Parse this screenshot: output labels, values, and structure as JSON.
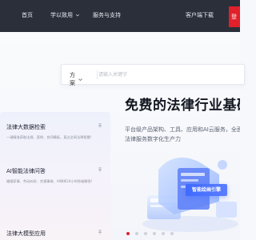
{
  "nav": {
    "items": [
      "首页",
      "学以致用",
      "服务与支持"
    ],
    "client_download": "客户端下载",
    "red_button": "登"
  },
  "search": {
    "scope": "方案",
    "placeholder": "请输入关键字"
  },
  "panel": {
    "items": [
      {
        "title": "法律大数据检索",
        "desc": "一键精准获取法规、案例、合同模板，直达全网法律智慧!"
      },
      {
        "title": "AI智能法律问答",
        "desc": "婚姻家事、劳动纠纷、交通事故，AI律师24小时秒级解答!"
      },
      {
        "title": "法律大模型应用",
        "desc": ""
      }
    ]
  },
  "hero": {
    "headline": "免费的法律行业基础设施",
    "sub_line1": "平台级产品架构、工具、应用和AI云服务，全面提",
    "sub_line2": "法律服务数字化生产力",
    "cta": "智能绘画引擎"
  },
  "carousel": {
    "count": 6,
    "active_index": 0
  },
  "colors": {
    "nav_bg": "#2b2f3a",
    "accent_red": "#e0202a",
    "cta_blue": "#3f6bff"
  }
}
